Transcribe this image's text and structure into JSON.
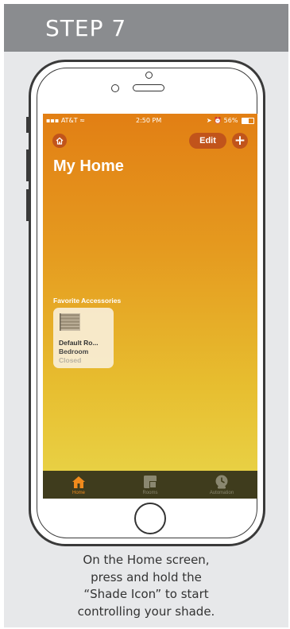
{
  "step": {
    "title": "STEP 7"
  },
  "status_bar": {
    "carrier": "AT&T",
    "time": "2:50 PM",
    "battery": "56%"
  },
  "toolbar": {
    "edit_label": "Edit",
    "add_label": "+",
    "home_icon": "house-icon"
  },
  "page": {
    "title": "My Home"
  },
  "favorites": {
    "section_label": "Favorite Accessories",
    "accessory": {
      "name": "Default Ro...",
      "room": "Bedroom",
      "state": "Closed",
      "icon": "window-shade-icon"
    }
  },
  "tabbar": {
    "tabs": [
      {
        "label": "Home",
        "icon": "house-icon",
        "active": true
      },
      {
        "label": "Rooms",
        "icon": "rooms-icon",
        "active": false
      },
      {
        "label": "Automation",
        "icon": "clock-icon",
        "active": false
      }
    ]
  },
  "caption": {
    "lines": [
      "On the Home screen,",
      "press and hold the",
      "“Shade Icon” to start",
      "controlling your shade."
    ]
  },
  "colors": {
    "accent": "#e27f14",
    "button": "#c1541b",
    "tab_active": "#f08a1c",
    "tab_inactive": "#8a8770",
    "header": "#8a8c8f"
  }
}
